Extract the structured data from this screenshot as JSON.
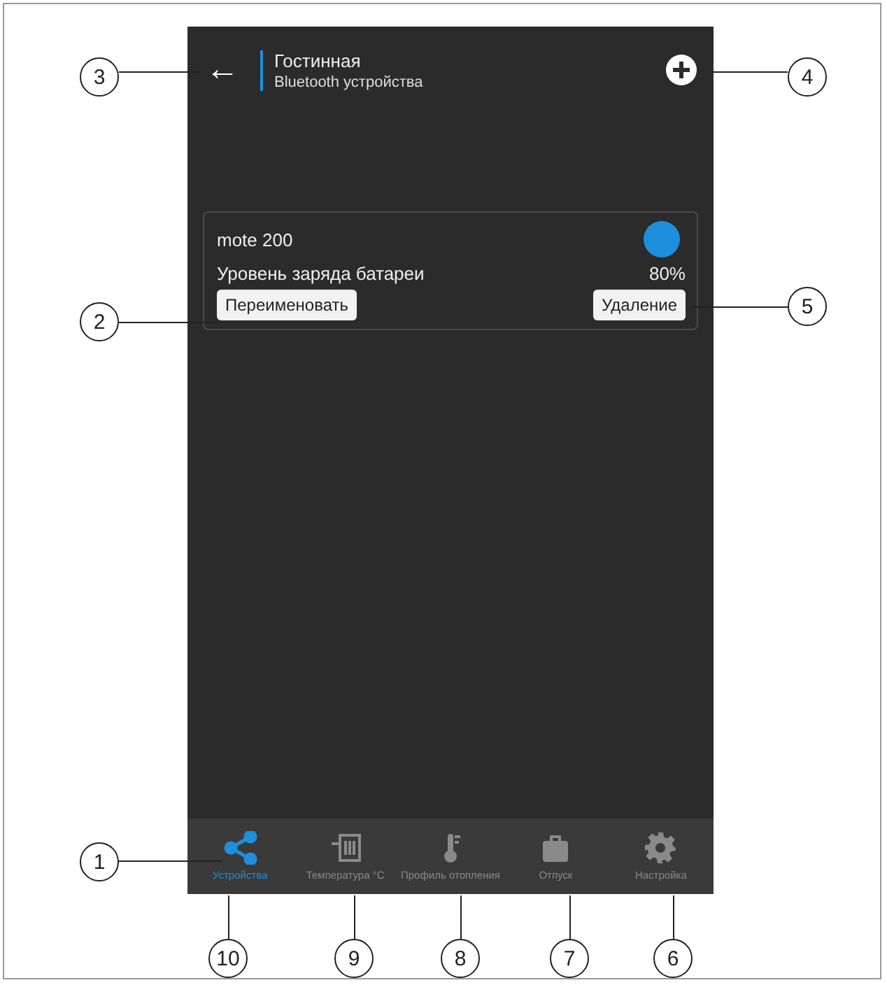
{
  "header": {
    "back_icon": "←",
    "title": "Гостинная",
    "subtitle": "Bluetooth устройства"
  },
  "device": {
    "name": "mote 200",
    "color": "#1e8fdc",
    "battery_label": "Уровень заряда батареи",
    "battery_value": "80%",
    "buttons": [
      "Переименовать",
      "Удаление"
    ]
  },
  "tabs": [
    {
      "label": "Устройства",
      "selected": true
    },
    {
      "label": "Температура °C",
      "selected": false
    },
    {
      "label": "Профиль отопления",
      "selected": false
    },
    {
      "label": "Отпуск",
      "selected": false
    },
    {
      "label": "Настройка",
      "selected": false
    }
  ],
  "callouts": [
    {
      "label": "3"
    },
    {
      "label": "4"
    },
    {
      "label": "2"
    },
    {
      "label": "5"
    },
    {
      "label": "1"
    },
    {
      "label": "10"
    },
    {
      "label": "9"
    },
    {
      "label": "8"
    },
    {
      "label": "7"
    },
    {
      "label": "6"
    }
  ]
}
